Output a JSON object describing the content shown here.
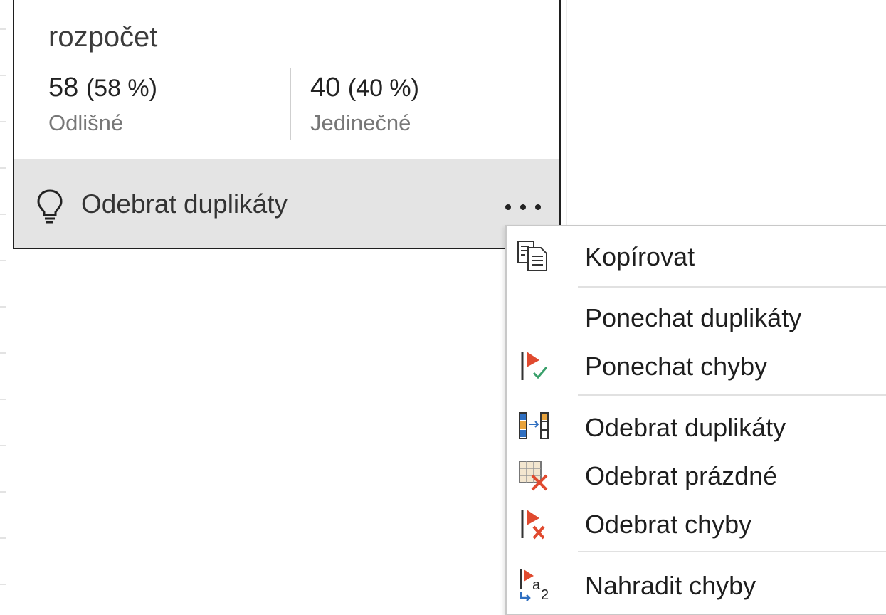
{
  "card": {
    "title": "rozpočet",
    "stats": [
      {
        "value": "58",
        "percent": "(58 %)",
        "label": "Odlišné"
      },
      {
        "value": "40",
        "percent": "(40 %)",
        "label": "Jedinečné"
      }
    ],
    "footer": {
      "label": "Odebrat duplikáty",
      "icon": "lightbulb-icon",
      "more_icon": "ellipsis-icon"
    }
  },
  "menu": {
    "items": [
      {
        "label": "Kopírovat",
        "icon": "copy-icon"
      },
      {
        "label": "Ponechat duplikáty",
        "icon": ""
      },
      {
        "label": "Ponechat chyby",
        "icon": "keep-errors-icon"
      },
      {
        "label": "Odebrat duplikáty",
        "icon": "remove-duplicates-icon"
      },
      {
        "label": "Odebrat prázdné",
        "icon": "remove-empty-icon"
      },
      {
        "label": "Odebrat chyby",
        "icon": "remove-errors-icon"
      },
      {
        "label": "Nahradit chyby",
        "icon": "replace-errors-icon"
      }
    ]
  },
  "colors": {
    "flag_red": "#e04a2f",
    "check_green": "#3aa06b",
    "blue": "#2f6fc1",
    "orange": "#e8a33c",
    "footer_bg": "#e4e4e4"
  }
}
